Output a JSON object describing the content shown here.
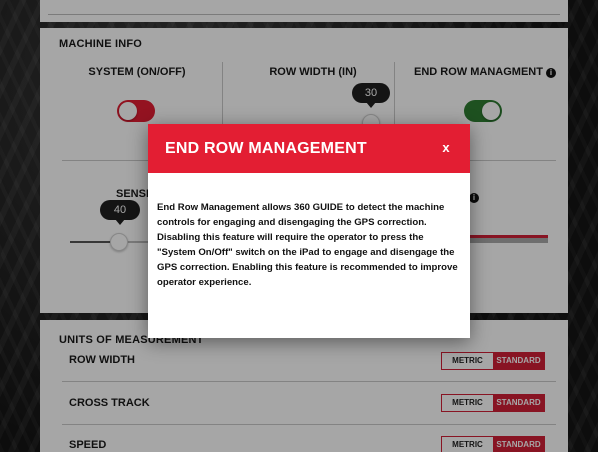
{
  "machine_info": {
    "section_title": "MACHINE INFO",
    "system": {
      "label": "SYSTEM (ON/OFF)",
      "state": "off"
    },
    "row_width": {
      "label": "ROW WIDTH (IN)",
      "value": "30"
    },
    "end_row_management": {
      "label": "END ROW MANAGMENT",
      "state": "on",
      "info_icon": "info-icon"
    },
    "sensitivity": {
      "label_partial": "SENSI",
      "value": "40",
      "level_fraction": 0.25
    }
  },
  "units": {
    "section_title": "UNITS OF MEASUREMENT",
    "rows": [
      {
        "label": "ROW WIDTH",
        "metric": "METRIC",
        "standard": "STANDARD",
        "selected": "STANDARD"
      },
      {
        "label": "CROSS TRACK",
        "metric": "METRIC",
        "standard": "STANDARD",
        "selected": "STANDARD"
      },
      {
        "label": "SPEED",
        "metric": "METRIC",
        "standard": "STANDARD",
        "selected": "STANDARD"
      }
    ]
  },
  "modal": {
    "title": "END ROW MANAGEMENT",
    "close_label": "x",
    "body": "End Row Management allows 360 GUIDE to detect the machine controls for engaging and disengaging the GPS correction. Disabling this feature will require the operator to press the \"System On/Off\" switch on the iPad to engage and disengage the GPS correction. Enabling this feature is recommended to improve operator experience."
  },
  "colors": {
    "brand_red": "#e31e33",
    "toggle_on": "#2e7d32",
    "segment_red": "#d21f36"
  }
}
